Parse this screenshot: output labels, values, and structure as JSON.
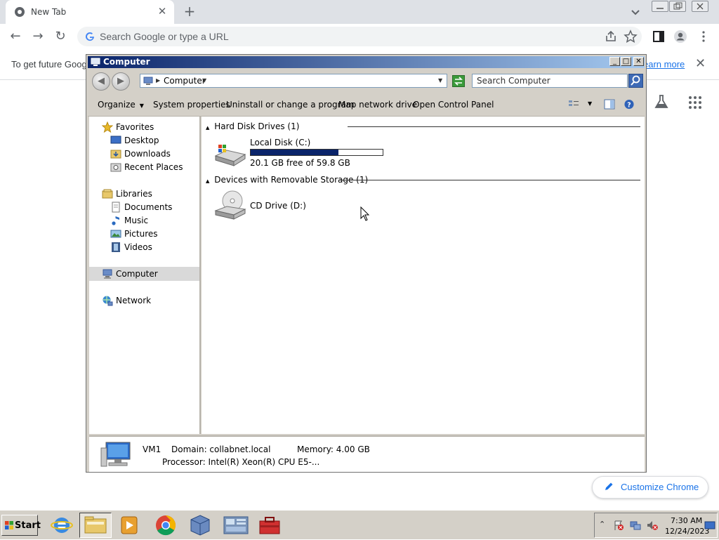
{
  "chrome": {
    "tab_title": "New Tab",
    "new_tab": "+",
    "omnibox_placeholder": "Search Google or type a URL",
    "infobar_text": "To get future Google",
    "infobar_link": "earn more",
    "customize_label": "Customize Chrome"
  },
  "explorer": {
    "title": "Computer",
    "address": "Computer",
    "search_placeholder": "Search Computer",
    "commands": [
      "Organize",
      "System properties",
      "Uninstall or change a program",
      "Map network drive",
      "Open Control Panel"
    ],
    "nav": {
      "favorites": "Favorites",
      "desktop": "Desktop",
      "downloads": "Downloads",
      "recent_places": "Recent Places",
      "libraries": "Libraries",
      "documents": "Documents",
      "music": "Music",
      "pictures": "Pictures",
      "videos": "Videos",
      "computer": "Computer",
      "network": "Network"
    },
    "groups": {
      "hdd": "Hard Disk Drives (1)",
      "removable": "Devices with Removable Storage (1)"
    },
    "drives": {
      "c_name": "Local Disk (C:)",
      "c_free": "20.1 GB free of 59.8 GB",
      "c_used_fraction": 0.664,
      "d_name": "CD Drive (D:)"
    },
    "details": {
      "name": "VM1",
      "domain": "Domain: collabnet.local",
      "memory": "Memory: 4.00 GB",
      "processor": "Processor: Intel(R) Xeon(R) CPU E5-..."
    }
  },
  "taskbar": {
    "start": "Start",
    "time": "7:30 AM",
    "date": "12/24/2023"
  },
  "colors": {
    "titlebar": "#0a246a",
    "drive_bar": "#0a246a",
    "link": "#1a73e8"
  }
}
